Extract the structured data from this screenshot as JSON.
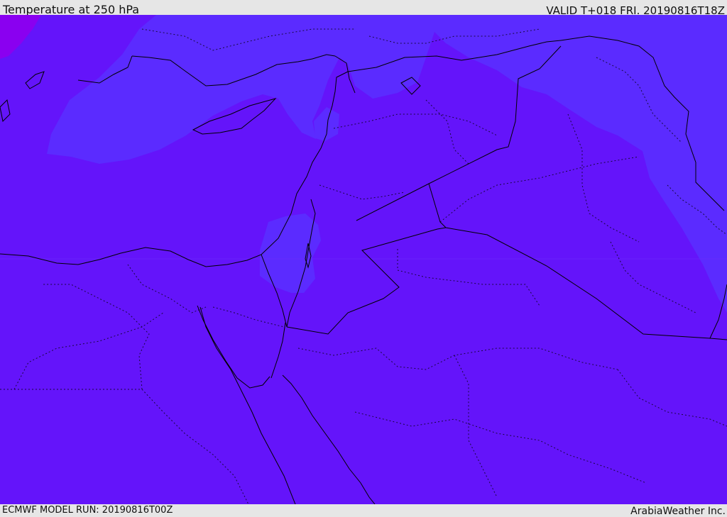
{
  "header": {
    "title": "Temperature at 250 hPa",
    "valid": "VALID T+018 FRI. 20190816T18Z"
  },
  "footer": {
    "model_run": "ECMWF MODEL RUN: 20190816T00Z",
    "credit": "ArabiaWeather Inc."
  },
  "map": {
    "field": "temperature",
    "level": "250 hPa",
    "colors": {
      "base_fill": "#6414fa",
      "cooler_fill": "#5b2bff",
      "coldest_fill": "#8a00f0",
      "coastline": "#000000",
      "admin_border": "#000000"
    }
  }
}
